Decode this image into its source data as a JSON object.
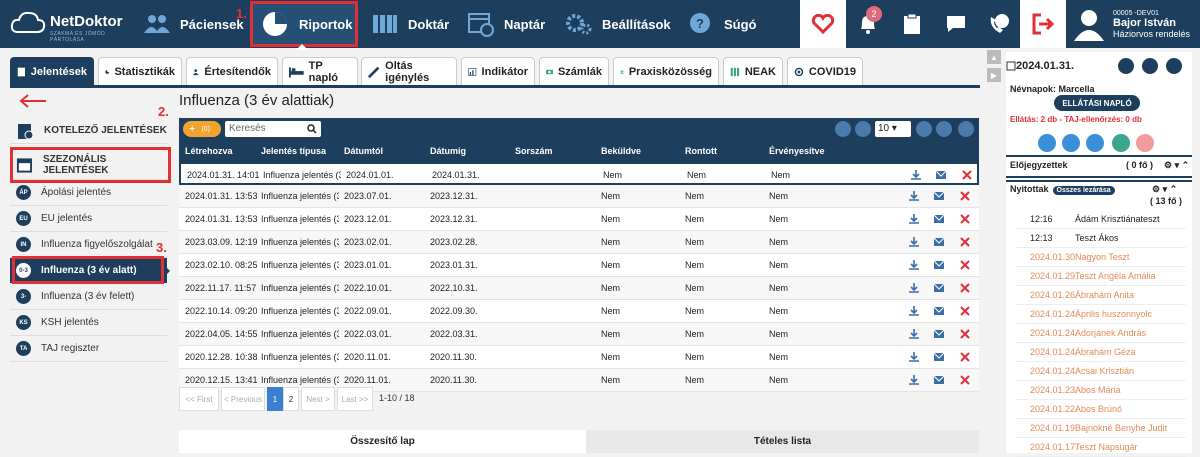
{
  "app": {
    "logo_name": "NetDoktor",
    "logo_sub": "SZAKMA ÉS JÓMÓD PÁRTOLÁSA"
  },
  "nav": {
    "paciensek": "Páciensek",
    "riportok": "Riportok",
    "doktar": "Doktár",
    "naptar": "Naptár",
    "beallitasok": "Beállítások",
    "sugo": "Súgó",
    "notif_count": "2",
    "user_code": "00005 -DEV01",
    "user_name": "Bajor István",
    "user_role": "Háziorvos rendelés"
  },
  "markers": {
    "m1": "1.",
    "m2": "2.",
    "m3": "3."
  },
  "tabs": [
    "Jelentések",
    "Statisztikák",
    "Értesítendők",
    "TP napló",
    "Oltás igénylés",
    "Indikátor",
    "Számlák",
    "Praxisközösség",
    "NEAK",
    "COVID19"
  ],
  "sidebar": {
    "items": [
      {
        "code": "",
        "label": "KOTELEZŐ JELENTÉSEK"
      },
      {
        "code": "",
        "label": "SZEZONÁLIS JELENTÉSEK"
      },
      {
        "code": "ÁP",
        "label": "Ápolási jelentés"
      },
      {
        "code": "EU",
        "label": "EU jelentés"
      },
      {
        "code": "IN",
        "label": "Influenza figyelőszolgálat"
      },
      {
        "code": "0-3",
        "label": "Influenza (3 év alatt)"
      },
      {
        "code": "3-",
        "label": "Influenza (3 év felett)"
      },
      {
        "code": "KS",
        "label": "KSH jelentés"
      },
      {
        "code": "TA",
        "label": "TAJ regiszter"
      }
    ]
  },
  "main": {
    "title": "Influenza (3 év alattiak)",
    "plus_count": "(0)",
    "search_placeholder": "Keresés",
    "page_size": "10",
    "columns": [
      "Létrehozva",
      "Jelentés típusa",
      "Dátumtól",
      "Dátumig",
      "Sorszám",
      "Beküldve",
      "Rontott",
      "Érvényesítve"
    ],
    "rows": [
      [
        "2024.01.31. 14:01",
        "Influenza jelentés (3",
        "2024.01.01.",
        "2024.01.31.",
        "",
        "Nem",
        "Nem",
        "Nem"
      ],
      [
        "2024.01.31. 13:53",
        "Influenza jelentés (3",
        "2023.07.01.",
        "2023.12.31.",
        "",
        "Nem",
        "Nem",
        "Nem"
      ],
      [
        "2024.01.31. 13:53",
        "Influenza jelentés (3",
        "2023.12.01.",
        "2023.12.31.",
        "",
        "Nem",
        "Nem",
        "Nem"
      ],
      [
        "2023.03.09. 12:19",
        "Influenza jelentés (3",
        "2023.02.01.",
        "2023.02.28.",
        "",
        "Nem",
        "Nem",
        "Nem"
      ],
      [
        "2023.02.10. 08:25",
        "Influenza jelentés (3",
        "2023.01.01.",
        "2023.01.31.",
        "",
        "Nem",
        "Nem",
        "Nem"
      ],
      [
        "2022.11.17. 11:57",
        "Influenza jelentés (3",
        "2022.10.01.",
        "2022.10.31.",
        "",
        "Nem",
        "Nem",
        "Nem"
      ],
      [
        "2022.10.14. 09:20",
        "Influenza jelentés (3",
        "2022.09.01.",
        "2022.09.30.",
        "",
        "Nem",
        "Nem",
        "Nem"
      ],
      [
        "2022.04.05. 14:55",
        "Influenza jelentés (3",
        "2022.03.01.",
        "2022.03.31.",
        "",
        "Nem",
        "Nem",
        "Nem"
      ],
      [
        "2020.12.28. 10:38",
        "Influenza jelentés (3",
        "2020.11.01.",
        "2020.11.30.",
        "",
        "Nem",
        "Nem",
        "Nem"
      ],
      [
        "2020.12.15. 13:41",
        "Influenza jelentés (3",
        "2020.11.01.",
        "2020.11.30.",
        "",
        "Nem",
        "Nem",
        "Nem"
      ]
    ],
    "pager": {
      "first": "<< First",
      "prev": "< Previous",
      "p1": "1",
      "p2": "2",
      "next": "Next >",
      "last": "Last >>",
      "info": "1-10 / 18"
    },
    "bottom_tabs": [
      "Összesítő lap",
      "Tételes lista"
    ]
  },
  "right": {
    "date": "2024.01.31.",
    "nevnapok": "Névnapok: Marcella",
    "ellatasi": "ELLÁTÁSI NAPLÓ",
    "ellatas_info": "Ellátás: 2 db - TAJ-ellenőrzés: 0 db",
    "elojegyzettek": "Előjegyzettek",
    "elojegyzettek_count": "( 0 fő )",
    "nyitottak": "Nyitottak",
    "osszes_lezarasa": "Összes lezárása",
    "nyitottak_count": "( 13 fő )",
    "patients": [
      {
        "t": "12:16",
        "n": "Ádám Krisztiánateszt",
        "old": false
      },
      {
        "t": "12:13",
        "n": "Teszt Ákos",
        "old": false
      },
      {
        "t": "2024.01.30.",
        "n": "Nagyon Teszt",
        "old": true
      },
      {
        "t": "2024.01.29.",
        "n": "Teszt Angéla Amália",
        "old": true
      },
      {
        "t": "2024.01.26.",
        "n": "Ábrahám Anita",
        "old": true
      },
      {
        "t": "2024.01.24.",
        "n": "Április huszonnyolc",
        "old": true
      },
      {
        "t": "2024.01.24.",
        "n": "Adorjánek András",
        "old": true
      },
      {
        "t": "2024.01.24.",
        "n": "Ábrahám Géza",
        "old": true
      },
      {
        "t": "2024.01.24.",
        "n": "Acsai Krisztián",
        "old": true
      },
      {
        "t": "2024.01.23.",
        "n": "Abos Mária",
        "old": true
      },
      {
        "t": "2024.01.22.",
        "n": "Abos Brúnó",
        "old": true
      },
      {
        "t": "2024.01.19.",
        "n": "Bajnokné Benyhe Judit",
        "old": true
      },
      {
        "t": "2024.01.17.",
        "n": "Teszt Napsugár",
        "old": true
      }
    ]
  },
  "colors": {
    "navy": "#1d3e5c",
    "red": "#e03036",
    "orange": "#f0a42e"
  }
}
